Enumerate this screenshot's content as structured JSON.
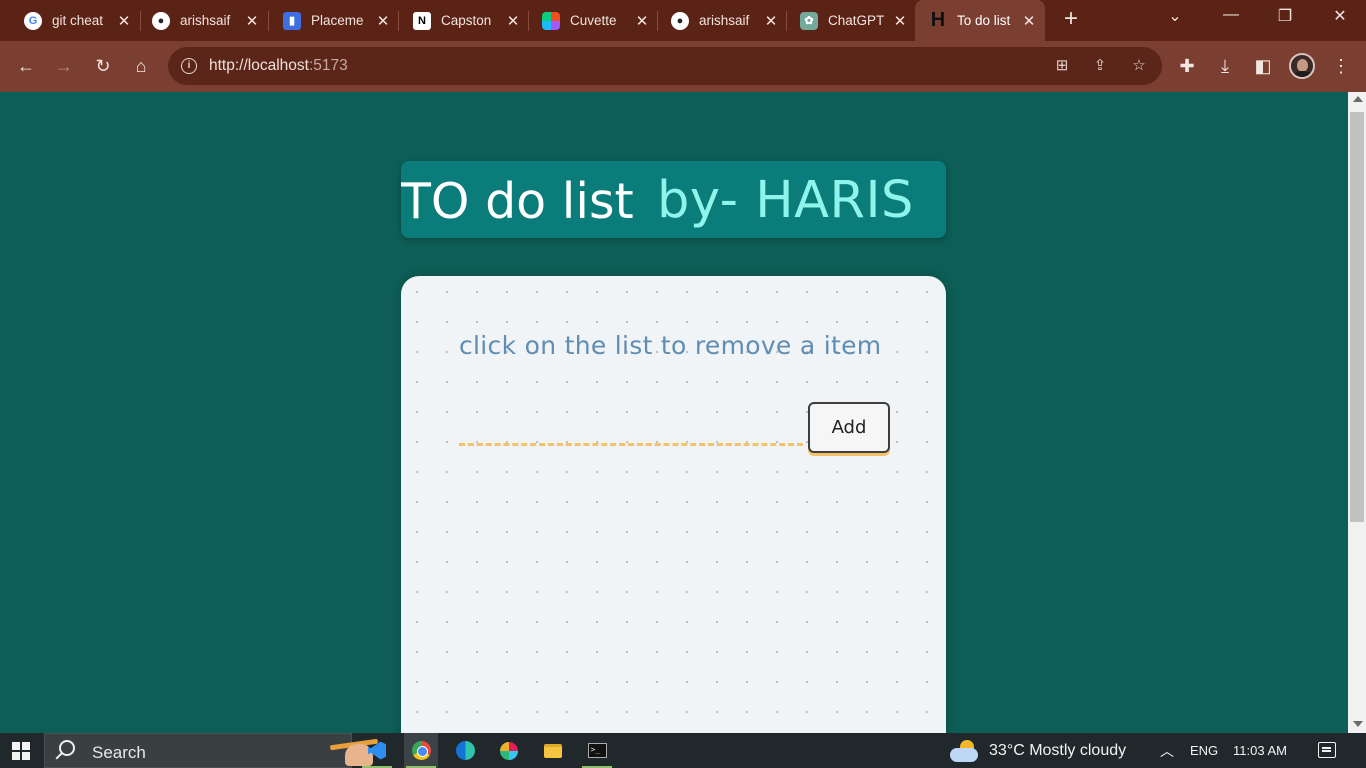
{
  "browser": {
    "tabs": [
      {
        "label": "git cheat",
        "icon": "google-icon"
      },
      {
        "label": "arishsaif",
        "icon": "github-icon"
      },
      {
        "label": "Placeme",
        "icon": "placement-icon"
      },
      {
        "label": "Capston",
        "icon": "notion-icon"
      },
      {
        "label": "Cuvette",
        "icon": "figma-icon"
      },
      {
        "label": "arishsaif",
        "icon": "github-icon"
      },
      {
        "label": "ChatGPT",
        "icon": "chatgpt-icon"
      },
      {
        "label": "To do list",
        "icon": "h-icon"
      }
    ],
    "url_host": "http://localhost",
    "url_port": ":5173"
  },
  "app": {
    "title_main": "TO do list",
    "title_accent": "by- HARIS",
    "instruction": "click on the list to remove a item",
    "input_value": "",
    "add_label": "Add"
  },
  "taskbar": {
    "search_label": "Search",
    "weather": "33°C  Mostly cloudy",
    "language": "ENG",
    "time": "11:03 AM"
  },
  "colors": {
    "page_bg": "#0d5e56",
    "title_bg": "#0a7c7a",
    "title_accent": "#8ff5ec",
    "instruction": "#5f8db3",
    "input_underline": "#f4c26b",
    "browser_frame": "#5b2216"
  }
}
